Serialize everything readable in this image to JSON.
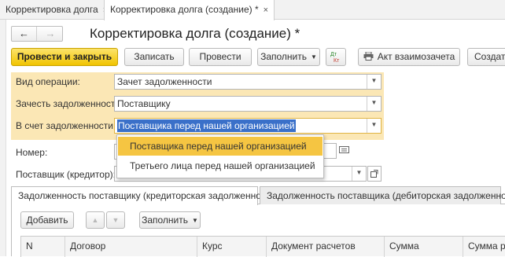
{
  "window_tabs": [
    {
      "label": "Корректировка долга",
      "close": "×"
    },
    {
      "label": "Корректировка долга (создание) *",
      "close": "×"
    }
  ],
  "nav": {
    "back": "←",
    "forward": "→"
  },
  "form_title": "Корректировка долга (создание) *",
  "toolbar": {
    "post_close": "Провести и закрыть",
    "save": "Записать",
    "post": "Провести",
    "fill": "Заполнить",
    "dtkt_top": "Дт",
    "dtkt_bottom": "Кт",
    "act": "Акт взаимозачета",
    "create": "Создать"
  },
  "fields": {
    "operation_label": "Вид операции:",
    "operation_value": "Зачет задолженности",
    "offset_label": "Зачесть задолженность:",
    "offset_value": "Поставщику",
    "account_label": "В счет задолженности:",
    "account_value": "Поставщика перед нашей организацией",
    "number_label": "Номер:",
    "supplier_label": "Поставщик (кредитор):"
  },
  "dropdown_options": [
    "Поставщика перед нашей организацией",
    "Третьего лица перед нашей организацией"
  ],
  "bottom_tabs": [
    "Задолженность поставщику (кредиторская задолженность)",
    "Задолженность поставщика (дебиторская задолженность)"
  ],
  "table_toolbar": {
    "add": "Добавить",
    "up": "▲",
    "down": "▼",
    "fill": "Заполнить"
  },
  "columns": [
    "N",
    "Договор",
    "Курс",
    "Документ расчетов",
    "Сумма",
    "Сумма ра"
  ],
  "colors": {
    "accent": "#f1c400",
    "highlight_bg": "#fbe7b5",
    "selection": "#3a70c9",
    "option_highlight": "#f5c542"
  }
}
